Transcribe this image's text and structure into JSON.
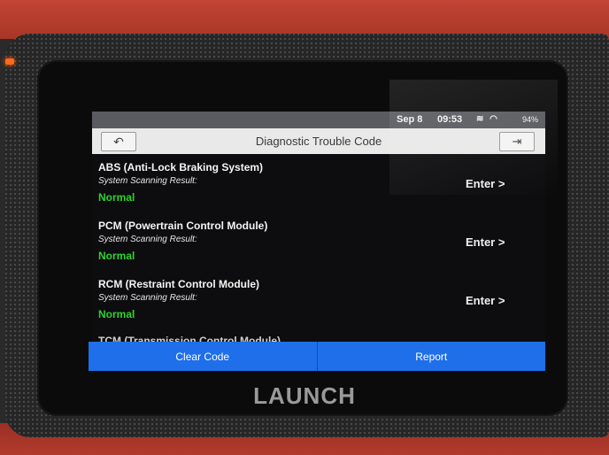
{
  "status": {
    "date": "Sep 8",
    "time": "09:53",
    "battery": "94%"
  },
  "header": {
    "title": "Diagnostic Trouble Code",
    "back_icon": "back-arrow-icon",
    "exit_icon": "exit-icon"
  },
  "modules": [
    {
      "name": "ABS (Anti-Lock Braking System)",
      "label": "System Scanning Result:",
      "result": "Normal",
      "action": "Enter >"
    },
    {
      "name": "PCM (Powertrain Control Module)",
      "label": "System Scanning Result:",
      "result": "Normal",
      "action": "Enter >"
    },
    {
      "name": "RCM (Restraint Control Module)",
      "label": "System Scanning Result:",
      "result": "Normal",
      "action": "Enter >"
    }
  ],
  "partial_module": "TCM (Transmission Control Module)",
  "actions": {
    "clear_code": "Clear Code",
    "report": "Report"
  },
  "brand": "LAUNCH",
  "colors": {
    "accent": "#1f6fea",
    "normal": "#2fd12f",
    "device": "#b23b2c"
  }
}
